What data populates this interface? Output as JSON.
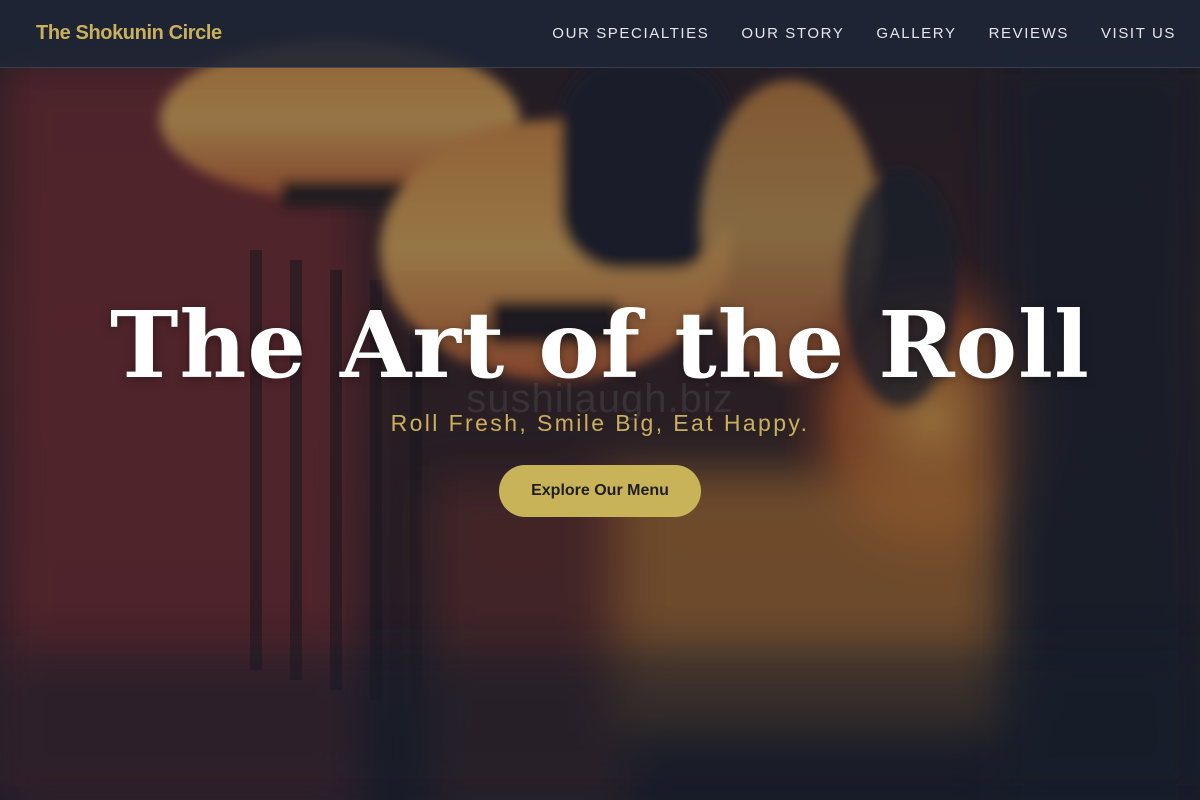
{
  "navbar": {
    "brand": "The Shokunin Circle",
    "links": [
      {
        "label": "OUR SPECIALTIES"
      },
      {
        "label": "OUR STORY"
      },
      {
        "label": "GALLERY"
      },
      {
        "label": "REVIEWS"
      },
      {
        "label": "VISIT US"
      }
    ]
  },
  "hero": {
    "title": "The Art of the Roll",
    "subtitle": "Roll Fresh, Smile Big, Eat Happy.",
    "cta_label": "Explore Our Menu",
    "watermark": "sushilaugh.biz",
    "background_image": "japanese-lanterns-photo"
  },
  "colors": {
    "accent": "#c9b05d",
    "button": "#c9b358",
    "nav_bg": "#1e2636",
    "title": "#ffffff"
  }
}
